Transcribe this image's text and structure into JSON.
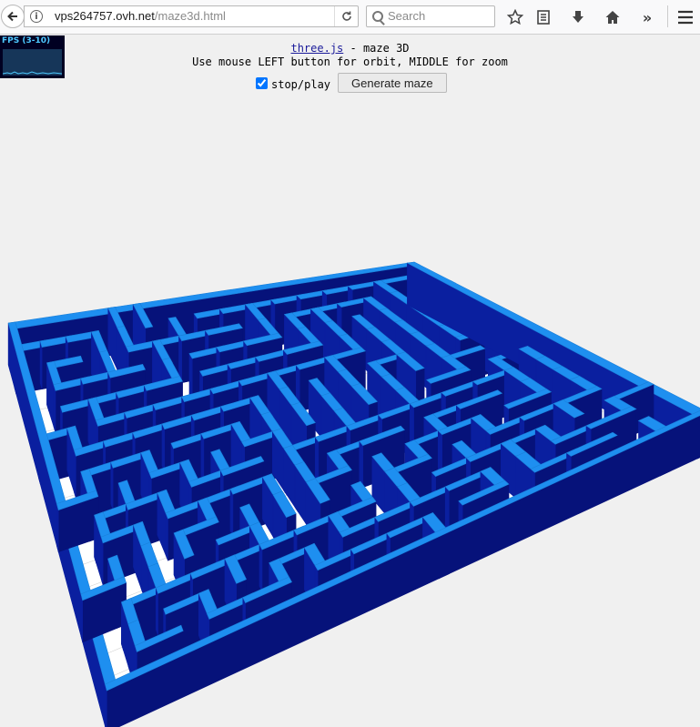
{
  "browser": {
    "url_host": "vps264757.ovh.net",
    "url_path": "/maze3d.html",
    "search_placeholder": "Search"
  },
  "fps": {
    "label": "FPS (3-10)"
  },
  "info": {
    "link_text": "three.js",
    "title_rest": " - maze 3D",
    "instructions": "Use mouse LEFT button for orbit, MIDDLE for zoom"
  },
  "controls": {
    "checkbox_label": "stop/play",
    "checkbox_checked": true,
    "generate_button": "Generate maze"
  },
  "colors": {
    "page_bg": "#f0f0f0",
    "wall_top": "#1e8ff0",
    "wall_face_dark": "#06127a",
    "wall_face_mid": "#0a1f9f",
    "floor": "#ffffff"
  }
}
